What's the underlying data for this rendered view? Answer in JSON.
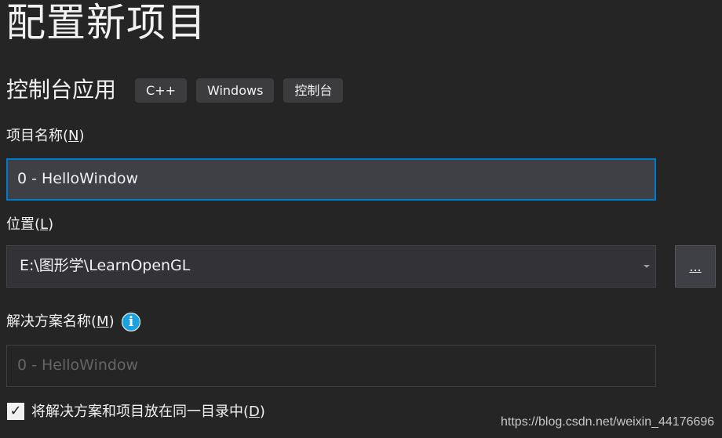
{
  "page_title": "配置新项目",
  "template": {
    "name": "控制台应用",
    "tags": [
      "C++",
      "Windows",
      "控制台"
    ]
  },
  "project_name": {
    "label": "项目名称",
    "accesskey": "N",
    "value": "0 - HelloWindow"
  },
  "location": {
    "label": "位置",
    "accesskey": "L",
    "value": "E:\\图形学\\LearnOpenGL",
    "browse_label": "..."
  },
  "solution_name": {
    "label": "解决方案名称",
    "accesskey": "M",
    "placeholder": "0 - HelloWindow",
    "info_icon": "info-icon"
  },
  "same_directory": {
    "label": "将解决方案和项目放在同一目录中",
    "accesskey": "D",
    "checked": true
  },
  "watermark": "https://blog.csdn.net/weixin_44176696",
  "colors": {
    "background": "#252526",
    "focus_border": "#007acc",
    "info_blue": "#1ba1e2"
  }
}
